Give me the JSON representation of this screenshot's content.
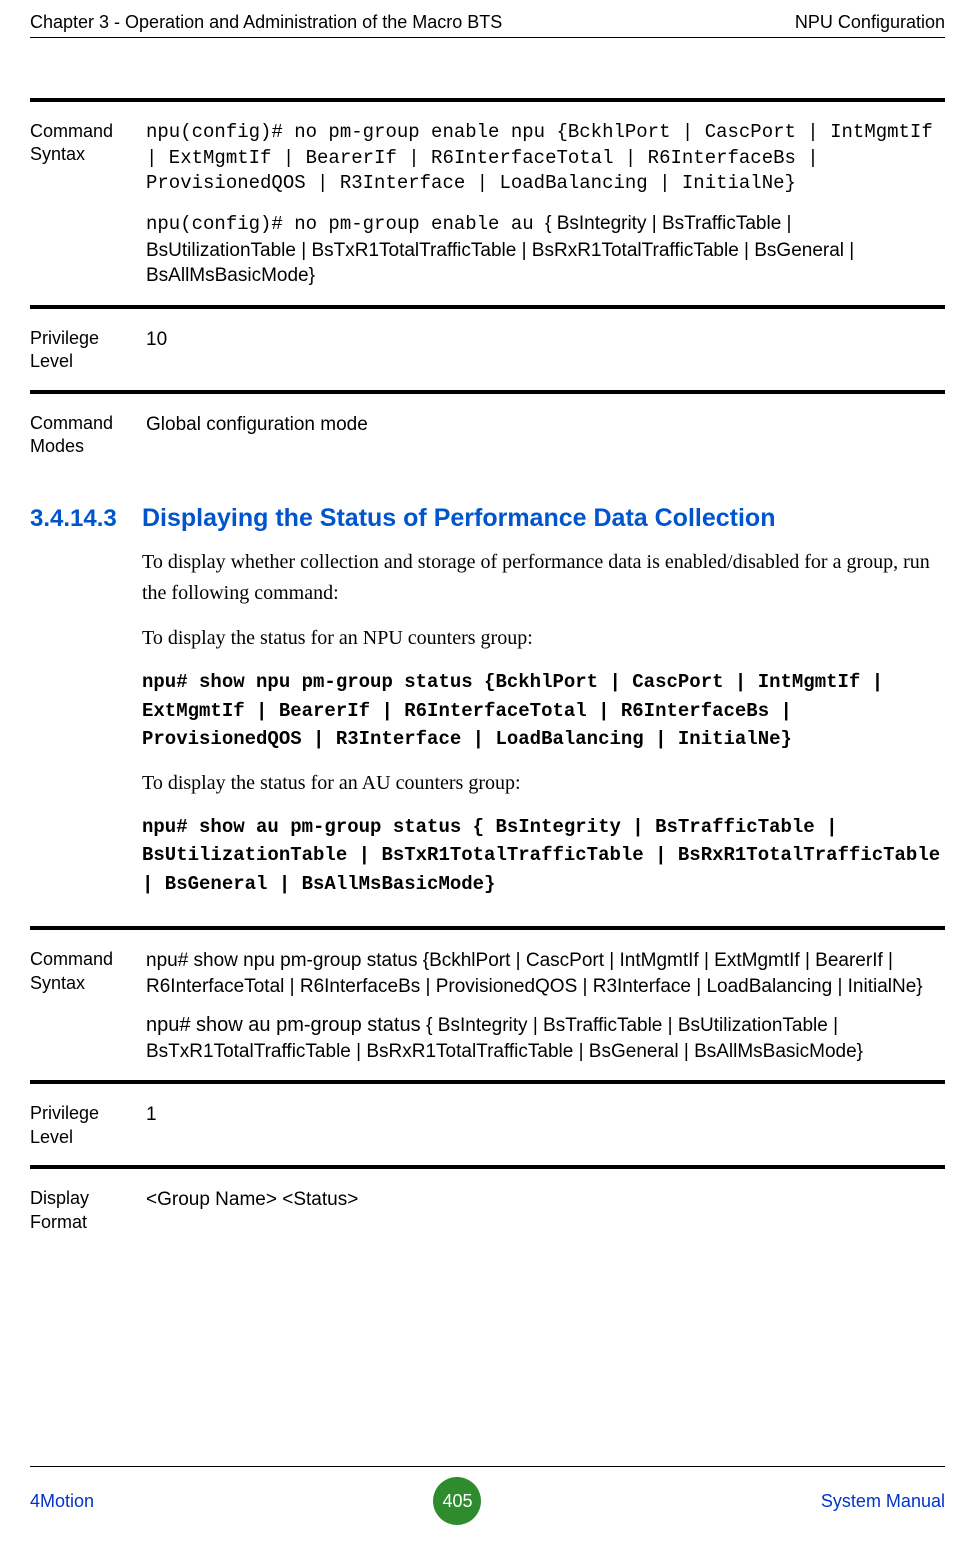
{
  "header": {
    "left": "Chapter 3 - Operation and Administration of the Macro BTS",
    "right": "NPU Configuration"
  },
  "block1": {
    "row1": {
      "label": "Command Syntax",
      "mono1": "npu(config)# no pm-group enable npu {BckhlPort | CascPort | IntMgmtIf | ExtMgmtIf | BearerIf | R6InterfaceTotal | R6InterfaceBs | ProvisionedQOS | R3Interface | LoadBalancing | InitialNe}",
      "mono2_prefix": "npu(config)# no pm-group enable au ",
      "sans_suffix": "{ BsIntegrity | BsTrafficTable | BsUtilizationTable | BsTxR1TotalTrafficTable | BsRxR1TotalTrafficTable | BsGeneral | BsAllMsBasicMode}"
    },
    "row2": {
      "label": "Privilege Level",
      "value": "10"
    },
    "row3": {
      "label": "Command Modes",
      "value": "Global configuration mode"
    }
  },
  "section": {
    "num": "3.4.14.3",
    "title": "Displaying the Status of Performance Data Collection",
    "p1": "To display whether collection and storage of performance data is enabled/disabled for a group, run the following command:",
    "p2": "To display the status for an NPU counters group:",
    "cmd1": "npu# show npu pm-group status {BckhlPort | CascPort | IntMgmtIf | ExtMgmtIf | BearerIf | R6InterfaceTotal | R6InterfaceBs | ProvisionedQOS | R3Interface | LoadBalancing | InitialNe}",
    "p3": "To display the status for an AU counters group:",
    "cmd2": "npu# show au pm-group status { BsIntegrity | BsTrafficTable | BsUtilizationTable | BsTxR1TotalTrafficTable | BsRxR1TotalTrafficTable | BsGeneral | BsAllMsBasicMode}"
  },
  "block2": {
    "row1": {
      "label": "Command Syntax",
      "line1": "npu# show npu pm-group status {BckhlPort | CascPort | IntMgmtIf | ExtMgmtIf | BearerIf | R6InterfaceTotal | R6InterfaceBs | ProvisionedQOS | R3Interface | LoadBalancing | InitialNe}",
      "line2_prefix": "npu# show au pm-group status  ",
      "line2_suffix": "{ BsIntegrity | BsTrafficTable | BsUtilizationTable | BsTxR1TotalTrafficTable | BsRxR1TotalTrafficTable | BsGeneral | BsAllMsBasicMode}"
    },
    "row2": {
      "label": "Privilege Level",
      "value": "1"
    },
    "row3": {
      "label": "Display Format",
      "value": "<Group Name>   <Status>"
    }
  },
  "footer": {
    "left": "4Motion",
    "page": "405",
    "right": "System Manual"
  }
}
